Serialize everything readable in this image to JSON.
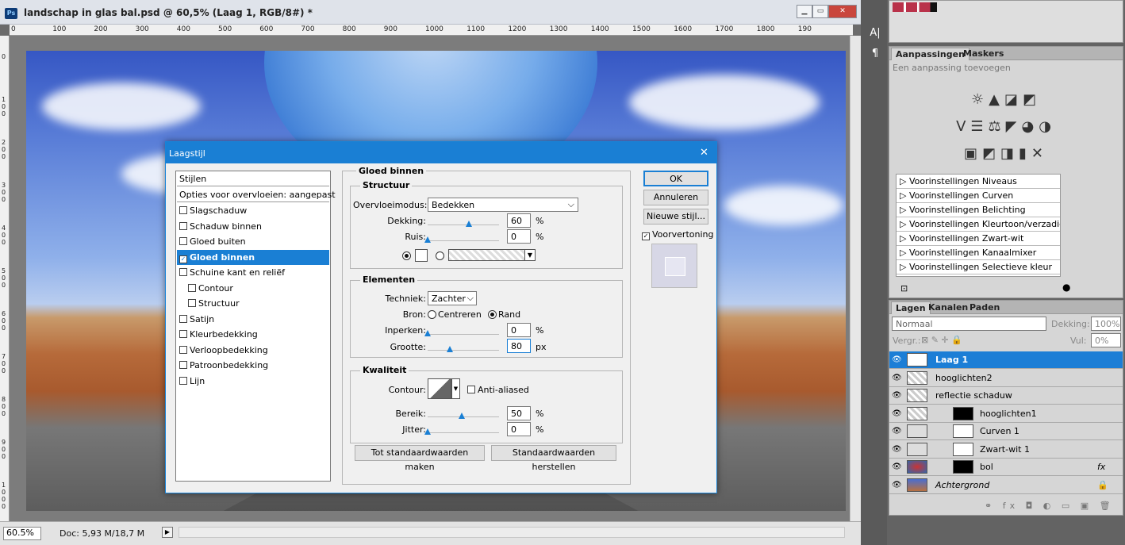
{
  "document": {
    "title": "landschap in glas bal.psd @ 60,5% (Laag 1, RGB/8#) *",
    "app_badge": "Ps",
    "ruler_top": [
      "0",
      "100",
      "200",
      "300",
      "400",
      "500",
      "600",
      "700",
      "800",
      "900",
      "1000",
      "1100",
      "1200",
      "1300",
      "1400",
      "1500",
      "1600",
      "1700",
      "1800",
      "190"
    ],
    "ruler_left": [
      "0",
      "1\n0\n0",
      "2\n0\n0",
      "3\n0\n0",
      "4\n0\n0",
      "5\n0\n0",
      "6\n0\n0",
      "7\n0\n0",
      "8\n0\n0",
      "9\n0\n0",
      "1\n0\n0\n0"
    ],
    "zoom": "60.5%",
    "doc_size": "Doc: 5,93 M/18,7 M"
  },
  "dialog": {
    "title": "Laagstijl",
    "styles_header": "Stijlen",
    "blend_options": "Opties voor overvloeien: aangepast",
    "styles": [
      {
        "label": "Slagschaduw",
        "checked": false,
        "indent": false
      },
      {
        "label": "Schaduw binnen",
        "checked": false,
        "indent": false
      },
      {
        "label": "Gloed buiten",
        "checked": false,
        "indent": false
      },
      {
        "label": "Gloed binnen",
        "checked": true,
        "indent": false,
        "selected": true
      },
      {
        "label": "Schuine kant en reliëf",
        "checked": false,
        "indent": false
      },
      {
        "label": "Contour",
        "checked": false,
        "indent": true
      },
      {
        "label": "Structuur",
        "checked": false,
        "indent": true
      },
      {
        "label": "Satijn",
        "checked": false,
        "indent": false
      },
      {
        "label": "Kleurbedekking",
        "checked": false,
        "indent": false
      },
      {
        "label": "Verloopbedekking",
        "checked": false,
        "indent": false
      },
      {
        "label": "Patroonbedekking",
        "checked": false,
        "indent": false
      },
      {
        "label": "Lijn",
        "checked": false,
        "indent": false
      }
    ],
    "section_title": "Gloed binnen",
    "structuur": {
      "title": "Structuur",
      "blend_mode_label": "Overvloeimodus:",
      "blend_mode_value": "Bedekken",
      "opacity_label": "Dekking:",
      "opacity_value": "60",
      "opacity_level": 0.6,
      "noise_label": "Ruis:",
      "noise_value": "0",
      "noise_level": 0,
      "unit_pct": "%"
    },
    "elementen": {
      "title": "Elementen",
      "technique_label": "Techniek:",
      "technique_value": "Zachter",
      "source_label": "Bron:",
      "source_center": "Centreren",
      "source_edge": "Rand",
      "choke_label": "Inperken:",
      "choke_value": "0",
      "choke_level": 0,
      "size_label": "Grootte:",
      "size_value": "80",
      "size_level": 0.32,
      "unit_px": "px"
    },
    "kwaliteit": {
      "title": "Kwaliteit",
      "contour_label": "Contour:",
      "anti_aliased": "Anti-aliased",
      "range_label": "Bereik:",
      "range_value": "50",
      "range_level": 0.5,
      "jitter_label": "Jitter:",
      "jitter_value": "0",
      "jitter_level": 0
    },
    "btn_make_default": "Tot standaardwaarden maken",
    "btn_reset_default": "Standaardwaarden herstellen",
    "btn_ok": "OK",
    "btn_cancel": "Annuleren",
    "btn_new_style": "Nieuwe stijl...",
    "preview_label": "Voorvertoning"
  },
  "adjustments": {
    "tab_active": "Aanpassingen",
    "tab_other": "Maskers",
    "subtitle": "Een aanpassing toevoegen",
    "presets": [
      "Voorinstellingen Niveaus",
      "Voorinstellingen Curven",
      "Voorinstellingen Belichting",
      "Voorinstellingen Kleurtoon/verzadiging",
      "Voorinstellingen Zwart-wit",
      "Voorinstellingen Kanaalmixer",
      "Voorinstellingen Selectieve kleur"
    ]
  },
  "layers": {
    "tabs": [
      "Lagen",
      "Kanalen",
      "Paden"
    ],
    "blend_mode": "Normaal",
    "opacity_label": "Dekking:",
    "opacity_value": "100%",
    "lock_label": "Vergr.:",
    "fill_label": "Vul:",
    "fill_value": "0%",
    "items": [
      {
        "name": "Laag 1",
        "selected": true
      },
      {
        "name": "hooglichten2",
        "selected": false
      },
      {
        "name": "reflectie schaduw",
        "selected": false
      },
      {
        "name": "hooglichten1",
        "selected": false
      },
      {
        "name": "Curven 1",
        "selected": false
      },
      {
        "name": "Zwart-wit 1",
        "selected": false
      },
      {
        "name": "bol",
        "selected": false,
        "fx": "fx"
      },
      {
        "name": "Achtergrond",
        "selected": false
      }
    ]
  },
  "colors": {
    "accent": "#1a7fd4"
  }
}
